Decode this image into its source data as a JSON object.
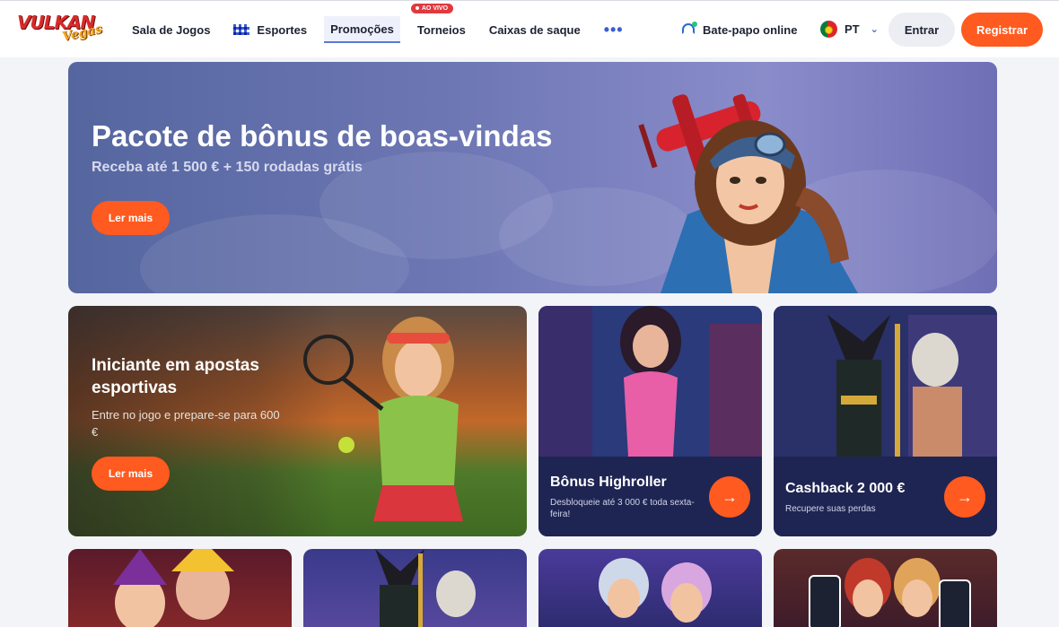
{
  "header": {
    "logo": {
      "word1": "VULKAN",
      "word2": "Vegas"
    },
    "nav": [
      {
        "label": "Sala de Jogos"
      },
      {
        "label": "Esportes",
        "icon": "checkered-flag-icon"
      },
      {
        "label": "Promoções",
        "active": true
      },
      {
        "label": "Torneios",
        "badge": "AO VIVO"
      },
      {
        "label": "Caixas de saque"
      }
    ],
    "more_icon": "•••",
    "chat_label": "Bate-papo online",
    "language": "PT",
    "login_label": "Entrar",
    "register_label": "Registrar"
  },
  "hero": {
    "title": "Pacote de bônus de boas-vindas",
    "subtitle": "Receba até 1 500 € + 150 rodadas grátis",
    "button_label": "Ler mais"
  },
  "sport": {
    "title": "Iniciante em apostas esportivas",
    "subtitle": "Entre no jogo e prepare-se para 600 €",
    "button_label": "Ler mais"
  },
  "promos": [
    {
      "title": "Bônus Highroller",
      "subtitle": "Desbloqueie até 3 000 € toda sexta-feira!"
    },
    {
      "title": "Cashback 2 000 €",
      "subtitle": "Recupere suas perdas"
    }
  ],
  "colors": {
    "accent": "#ff5a1f",
    "nav_active": "#5b78d6",
    "card_bottom": "#1f2552"
  }
}
